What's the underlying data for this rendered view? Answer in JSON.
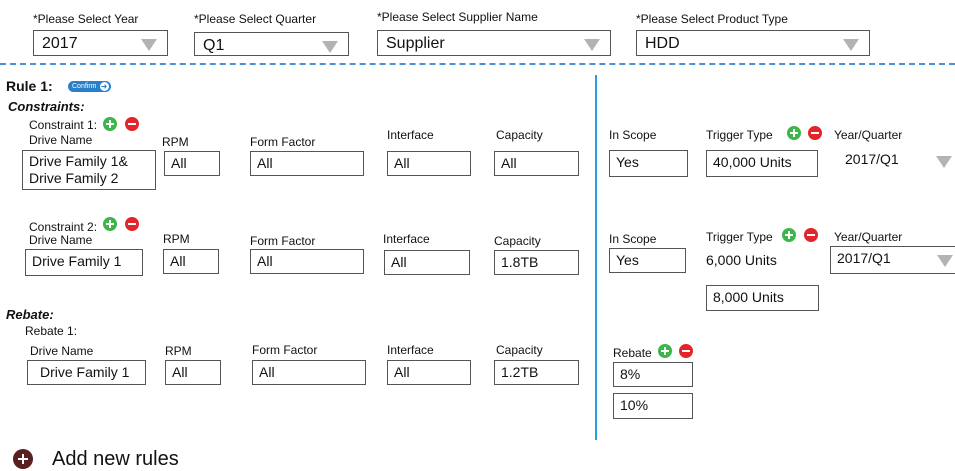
{
  "filters": {
    "year": {
      "label": "*Please Select Year",
      "value": "2017"
    },
    "quarter": {
      "label": "*Please Select Quarter",
      "value": "Q1"
    },
    "supplier": {
      "label": "*Please Select Supplier Name",
      "value": "Supplier"
    },
    "product": {
      "label": "*Please Select Product Type",
      "value": "HDD"
    }
  },
  "rule": {
    "title": "Rule 1:",
    "confirm_label": "Confirm",
    "constraints_heading": "Constraints:",
    "constraint1": {
      "label": "Constraint 1:",
      "drive_name_label": "Drive Name",
      "drive_name_line1": "Drive Family 1&",
      "drive_name_line2": "Drive Family 2",
      "rpm_label": "RPM",
      "rpm": "All",
      "form_factor_label": "Form Factor",
      "form_factor": "All",
      "interface_label": "Interface",
      "interface": "All",
      "capacity_label": "Capacity",
      "capacity": "All",
      "in_scope_label": "In Scope",
      "in_scope": "Yes",
      "trigger_type_label": "Trigger Type",
      "trigger_value": "40,000 Units",
      "year_quarter_label": "Year/Quarter",
      "year_quarter": "2017/Q1"
    },
    "constraint2": {
      "label": "Constraint 2:",
      "drive_name_label": "Drive Name",
      "drive_name": "Drive Family 1",
      "rpm_label": "RPM",
      "rpm": "All",
      "form_factor_label": "Form Factor",
      "form_factor": "All",
      "interface_label": "Interface",
      "interface": "All",
      "capacity_label": "Capacity",
      "capacity": "1.8TB",
      "in_scope_label": "In Scope",
      "in_scope": "Yes",
      "trigger_type_label": "Trigger Type",
      "trigger_values": [
        "6,000 Units",
        "8,000 Units"
      ],
      "year_quarter_label": "Year/Quarter",
      "year_quarter": "2017/Q1"
    },
    "rebate_heading": "Rebate:",
    "rebate1": {
      "label": "Rebate 1:",
      "drive_name_label": "Drive Name",
      "drive_name": "Drive Family 1",
      "rpm_label": "RPM",
      "rpm": "All",
      "form_factor_label": "Form Factor",
      "form_factor": "All",
      "interface_label": "Interface",
      "interface": "All",
      "capacity_label": "Capacity",
      "capacity": "1.2TB",
      "rebate_label": "Rebate",
      "rebate_values": [
        "8%",
        "10%"
      ]
    }
  },
  "add_rules_label": "Add new rules",
  "colors": {
    "divider": "#27a0dd",
    "plus": "#3cb549",
    "minus": "#e3242b",
    "add_icon": "#5a1f1f"
  }
}
